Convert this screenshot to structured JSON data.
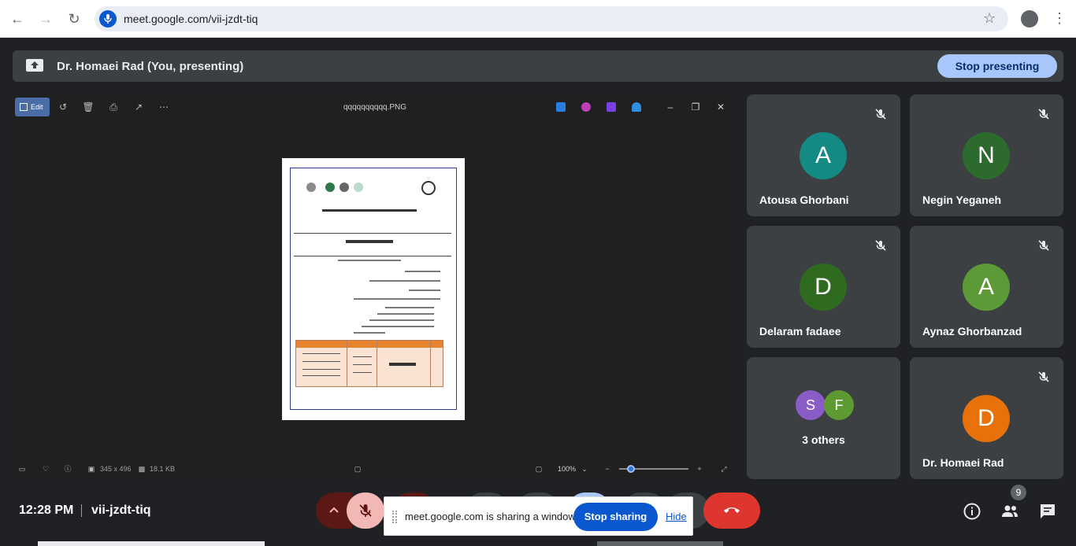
{
  "browser": {
    "url": "meet.google.com/vii-jzdt-tiq",
    "back_icon": "arrow-left-icon",
    "forward_icon": "arrow-right-icon",
    "reload_icon": "reload-icon"
  },
  "presenting": {
    "label": "Dr. Homaei Rad (You, presenting)",
    "stop_label": "Stop presenting"
  },
  "viewer": {
    "edit_label": "Edit",
    "file_name": "qqqqqqqqqq.PNG",
    "dimensions": "345 x 496",
    "file_size": "18.1 KB",
    "zoom": "100%"
  },
  "participants": [
    {
      "name": "Atousa Ghorbani",
      "initial": "A",
      "color": "#138a84",
      "muted": true
    },
    {
      "name": "Negin Yeganeh",
      "initial": "N",
      "color": "#2d6a2d",
      "muted": true
    },
    {
      "name": "Delaram fadaee",
      "initial": "D",
      "color": "#2e6b1f",
      "muted": true
    },
    {
      "name": "Aynaz Ghorbanzad",
      "initial": "A",
      "color": "#5b9a36",
      "muted": true
    },
    {
      "name": "Dr. Homaei Rad",
      "initial": "D",
      "color": "#e8710a",
      "muted": true
    }
  ],
  "others": {
    "label": "3 others",
    "avatars": [
      {
        "initial": "S",
        "color": "#8a5cc7"
      },
      {
        "initial": "F",
        "color": "#5e9a32"
      }
    ]
  },
  "bottom": {
    "time": "12:28 PM",
    "meeting_code": "vii-jzdt-tiq",
    "people_count": "9"
  },
  "share_notice": {
    "message": "meet.google.com is sharing a window.",
    "stop_label": "Stop sharing",
    "hide_label": "Hide"
  },
  "colors": {
    "stop_presenting_bg": "#a8c7fa",
    "end_call": "#dc362e",
    "mic_muted": "#f2b8b5",
    "accent_blue": "#0b57d0"
  }
}
